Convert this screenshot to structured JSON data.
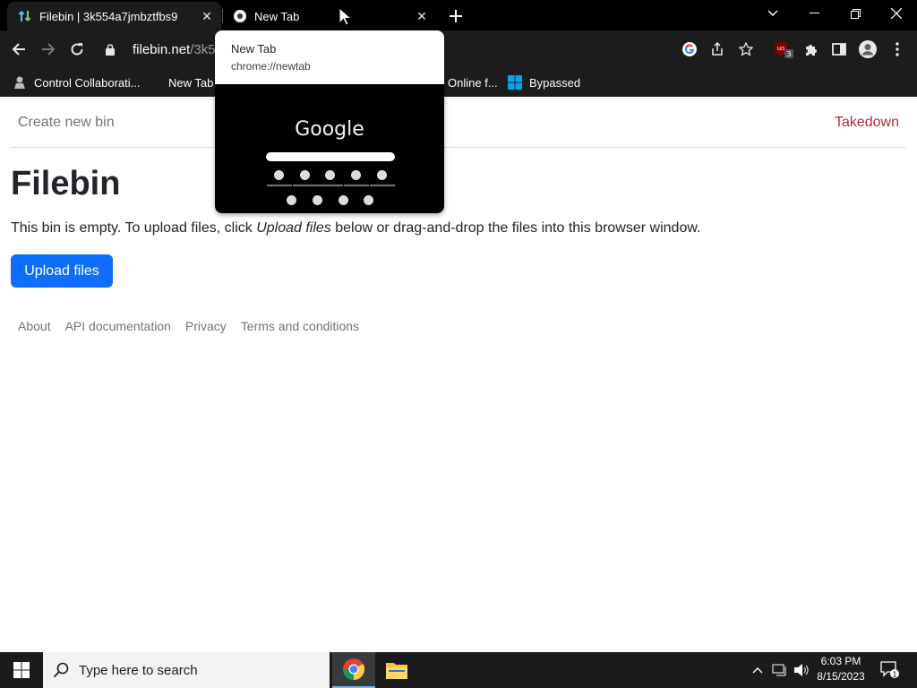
{
  "browser": {
    "tabs": [
      {
        "title": "Filebin | 3k554a7jmbztfbs9"
      },
      {
        "title": "New Tab"
      }
    ],
    "url": {
      "host": "filebin.net",
      "path": "/3k554"
    },
    "bookmarks": [
      {
        "label": "Control Collaborati..."
      },
      {
        "label": "New Tab"
      },
      {
        "label": "Online f..."
      },
      {
        "label": "Bypassed"
      }
    ],
    "extension_badge": "3",
    "hovercard": {
      "title": "New Tab",
      "url": "chrome://newtab",
      "preview_logo": "Google"
    }
  },
  "page": {
    "nav": {
      "create_label": "Create new bin",
      "takedown_label": "Takedown"
    },
    "heading": "Filebin",
    "message": {
      "before": "This bin is empty. To upload files, click ",
      "em": "Upload files",
      "after": " below or drag-and-drop the files into this browser window."
    },
    "upload_label": "Upload files",
    "footer": [
      "About",
      "API documentation",
      "Privacy",
      "Terms and conditions"
    ]
  },
  "taskbar": {
    "search_placeholder": "Type here to search",
    "time": "6:03 PM",
    "date": "8/15/2023",
    "notification_count": "1"
  },
  "colors": {
    "primary_button": "#0d6efd",
    "takedown": "#b02a37",
    "muted_text": "#6c757d"
  }
}
